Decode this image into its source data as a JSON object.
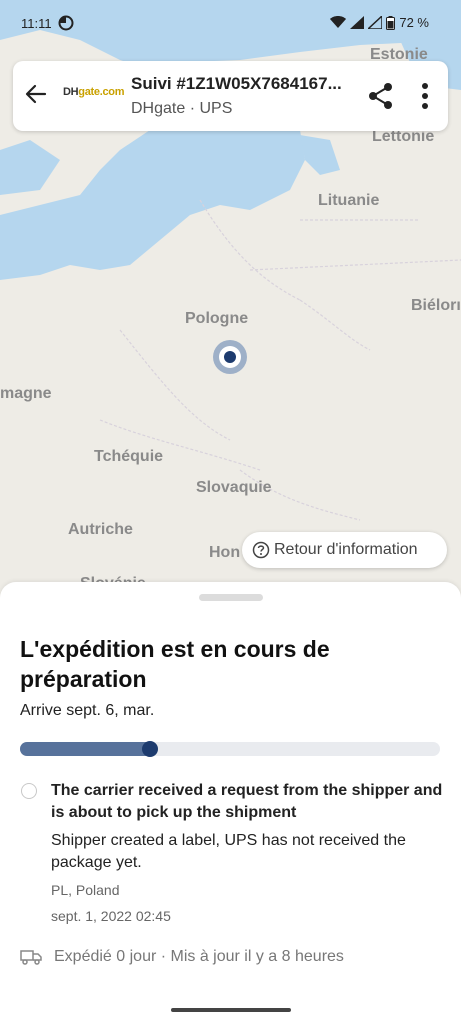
{
  "status_bar": {
    "time": "11:11",
    "battery": "72 %"
  },
  "map": {
    "labels": {
      "estonie": "Estonie",
      "lettonie": "Lettonie",
      "lituanie": "Lituanie",
      "bielorussie": "Biélorı",
      "pologne": "Pologne",
      "allemagne": "magne",
      "tchequie": "Tchéquie",
      "slovaquie": "Slovaquie",
      "autriche": "Autriche",
      "hongrie": "Hon",
      "slovenie": "Slovénie"
    }
  },
  "header": {
    "title": "Suivi #1Z1W05X7684167...",
    "subtitle": "DHgate · UPS",
    "logo_text_dh": "DH",
    "logo_text_gate": "gate.com"
  },
  "feedback_label": "Retour d'information",
  "shipment": {
    "headline": "L'expédition est en cours de préparation",
    "arrival": "Arrive sept. 6, mar.",
    "progress": 0.31,
    "event": {
      "title": "The carrier received a request from the shipper and is about to pick up the shipment",
      "description": "Shipper created a label, UPS has not received the package yet.",
      "location": "PL, Poland",
      "timestamp": "sept. 1, 2022 02:45"
    },
    "footer": "Expédié 0 jour · Mis à jour il y a 8 heures"
  },
  "colors": {
    "accent": "#1d3b6e",
    "progress_fill": "#57729b",
    "water": "#b5d6ee",
    "land": "#eeece6"
  },
  "icons": [
    "back-arrow-icon",
    "share-icon",
    "more-vert-icon",
    "help-circle-icon",
    "truck-icon",
    "location-pin-icon",
    "wifi-icon",
    "signal-icon",
    "battery-icon"
  ]
}
